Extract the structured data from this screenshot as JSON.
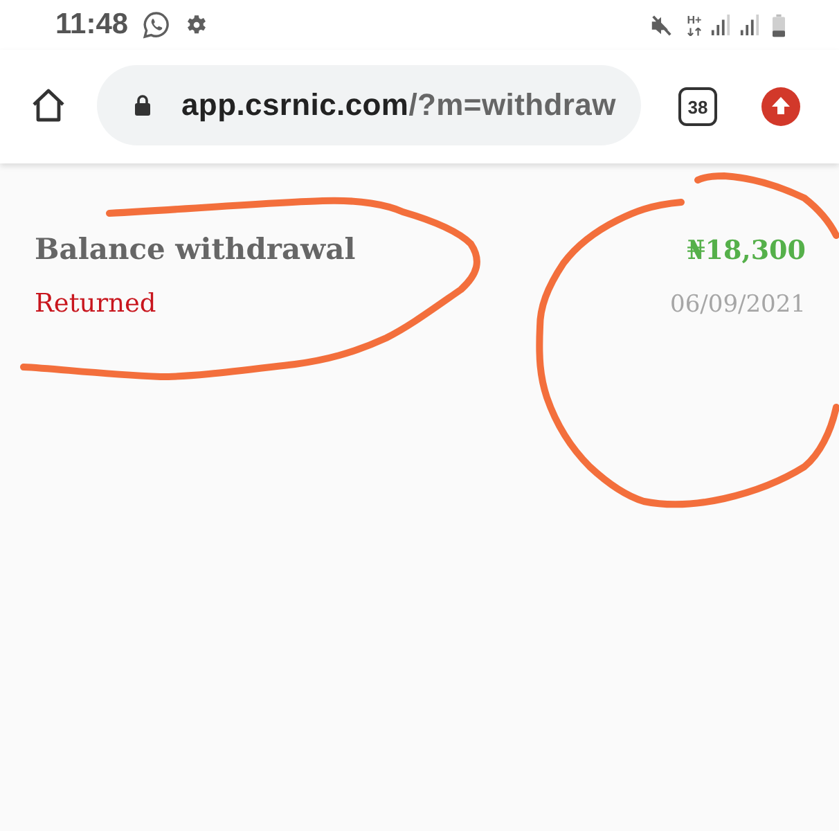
{
  "status_bar": {
    "time": "11:48",
    "network_type": "H+"
  },
  "address_bar": {
    "domain": "app.csrnic.com",
    "path": "/?m=withdraw",
    "tab_count": "38"
  },
  "transactions": [
    {
      "title": "Balance withdrawal",
      "status": {
        "label": "Returned",
        "color": "#c8161e"
      },
      "amount": "₦18,300",
      "date": "06/09/2021"
    }
  ]
}
